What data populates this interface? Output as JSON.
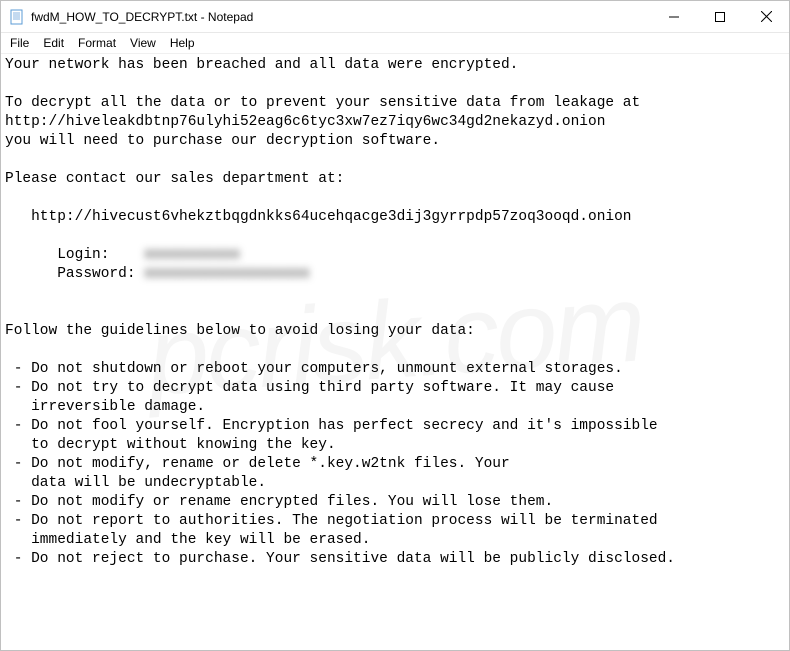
{
  "window": {
    "title": "fwdM_HOW_TO_DECRYPT.txt - Notepad"
  },
  "menu": {
    "file": "File",
    "edit": "Edit",
    "format": "Format",
    "view": "View",
    "help": "Help"
  },
  "body": {
    "l1": "Your network has been breached and all data were encrypted.",
    "l2": "",
    "l3": "To decrypt all the data or to prevent your sensitive data from leakage at",
    "l4": "http://hiveleakdbtnp76ulyhi52eag6c6tyc3xw7ez7iqy6wc34gd2nekazyd.onion",
    "l5": "you will need to purchase our decryption software.",
    "l6": "",
    "l7": "Please contact our sales department at:",
    "l8": "",
    "l9": "   http://hivecust6vhekztbqgdnkks64ucehqacge3dij3gyrrpdp57zoq3ooqd.onion",
    "l10": "",
    "l11a": "      Login:    ",
    "l11b": "xxxxxxxxxxx",
    "l12a": "      Password: ",
    "l12b": "xxxxxxxxxxxxxxxxxxx",
    "l13": "",
    "l14": "",
    "l15": "Follow the guidelines below to avoid losing your data:",
    "l16": "",
    "l17": " - Do not shutdown or reboot your computers, unmount external storages.",
    "l18": " - Do not try to decrypt data using third party software. It may cause ",
    "l19": "   irreversible damage.",
    "l20": " - Do not fool yourself. Encryption has perfect secrecy and it's impossible",
    "l21": "   to decrypt without knowing the key.",
    "l22": " - Do not modify, rename or delete *.key.w2tnk files. Your",
    "l23": "   data will be undecryptable.",
    "l24": " - Do not modify or rename encrypted files. You will lose them.",
    "l25": " - Do not report to authorities. The negotiation process will be terminated",
    "l26": "   immediately and the key will be erased.",
    "l27": " - Do not reject to purchase. Your sensitive data will be publicly disclosed."
  },
  "watermark": "pcrisk.com"
}
